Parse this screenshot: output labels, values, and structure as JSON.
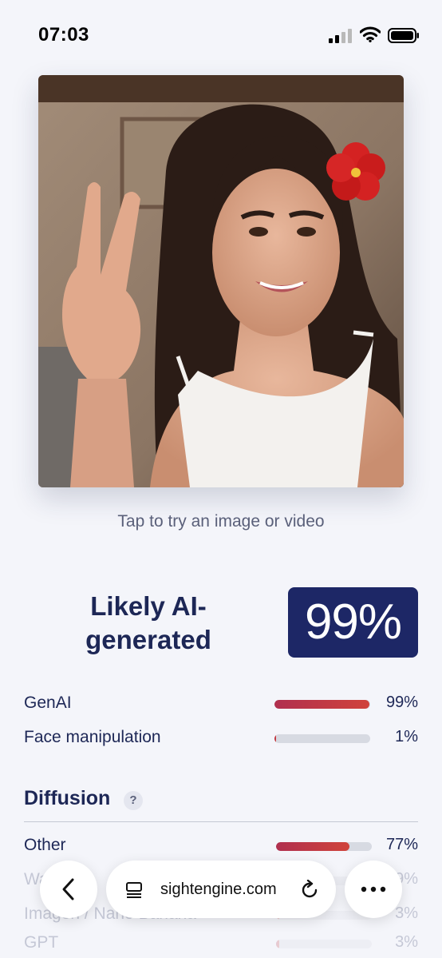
{
  "status_bar": {
    "time": "07:03",
    "icons": [
      "signal-icon",
      "wifi-icon",
      "battery-icon"
    ]
  },
  "upload": {
    "hint": "Tap to try an image or video"
  },
  "verdict": {
    "label": "Likely AI-generated",
    "score": "99%"
  },
  "categories": [
    {
      "label": "GenAI",
      "value": "99%",
      "fraction": 0.99
    },
    {
      "label": "Face manipulation",
      "value": "1%",
      "fraction": 0.01
    }
  ],
  "diffusion": {
    "title": "Diffusion",
    "help": "?",
    "items": [
      {
        "label": "Other",
        "value": "77%",
        "fraction": 0.77
      },
      {
        "label": "Wan",
        "value": "9%",
        "fraction": 0.09
      },
      {
        "label": "Imagen / Nano Banana",
        "value": "3%",
        "fraction": 0.03
      },
      {
        "label": "GPT",
        "value": "3%",
        "fraction": 0.03
      }
    ]
  },
  "browser": {
    "url": "sightengine.com",
    "icons": [
      "chevron-left-icon",
      "reader-icon",
      "reload-icon",
      "more-icon"
    ]
  },
  "colors": {
    "badge": "#1d2766",
    "bar_fill": "#c0343f",
    "bar_track": "#d7dae2",
    "text": "#1d2756"
  }
}
